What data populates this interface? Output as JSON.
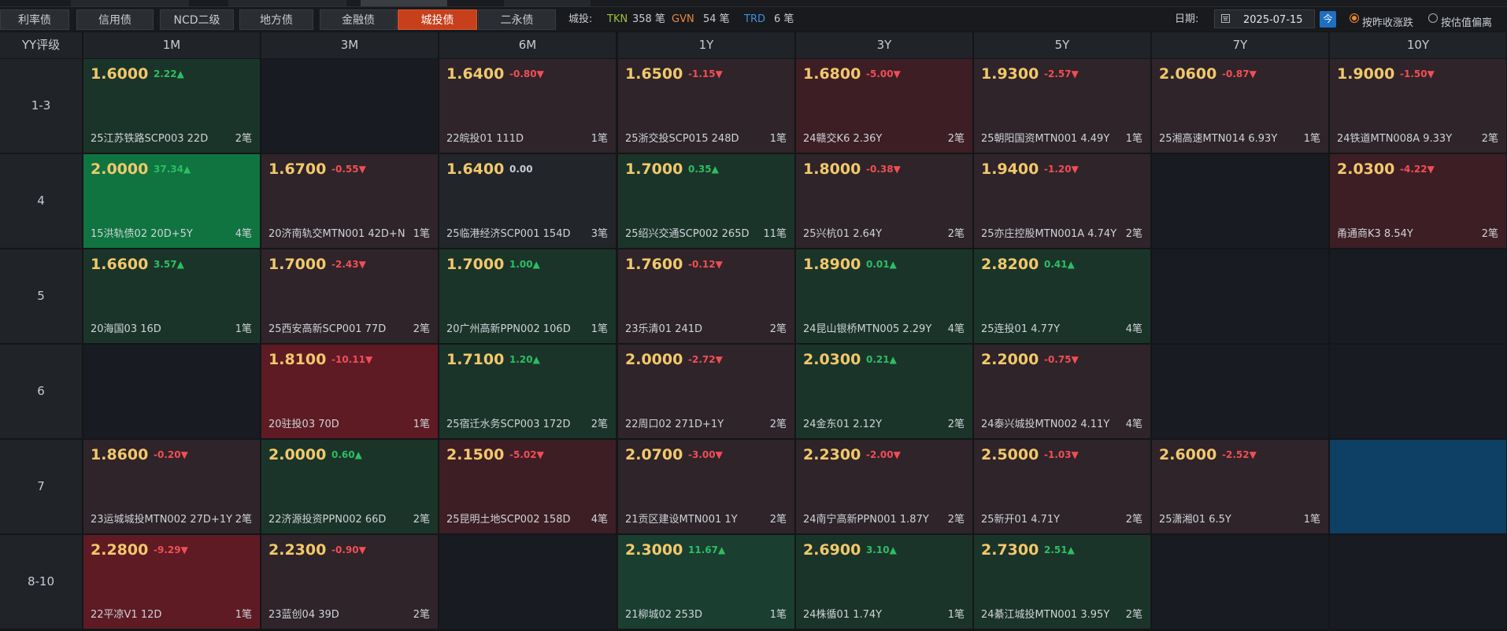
{
  "tabs": [
    {
      "label": "利率债",
      "active": false
    },
    {
      "label": "信用债",
      "active": false
    },
    {
      "label": "NCD二级",
      "active": false
    },
    {
      "label": "地方债",
      "active": false
    },
    {
      "label": "金融债",
      "active": false
    },
    {
      "label": "城投债",
      "active": true
    },
    {
      "label": "二永债",
      "active": false
    }
  ],
  "summary": {
    "prefix": "城投:",
    "items": [
      {
        "code": "TKN",
        "count": "358 笔",
        "color": "#9fc33a"
      },
      {
        "code": "GVN",
        "count": "54 笔",
        "color": "#e88a3c"
      },
      {
        "code": "TRD",
        "count": "6 笔",
        "color": "#3e8fe0"
      }
    ]
  },
  "date": {
    "label": "日期:",
    "value": "2025-07-15",
    "today_label": "今"
  },
  "radios": [
    {
      "label": "按昨收涨跌",
      "checked": true
    },
    {
      "label": "按估值偏离",
      "checked": false
    }
  ],
  "grid": {
    "corner": "YY评级",
    "columns": [
      "1M",
      "3M",
      "6M",
      "1Y",
      "3Y",
      "5Y",
      "7Y",
      "10Y"
    ],
    "rows": [
      "1-3",
      "4",
      "5",
      "6",
      "7",
      "8-10"
    ],
    "cells": [
      [
        {
          "value": "1.6000",
          "change": "2.22▲",
          "dir": "up",
          "bond": "25江苏铁路SCP003 22D",
          "count": "2笔",
          "shade": "dg"
        },
        {
          "shade": "em"
        },
        {
          "value": "1.6400",
          "change": "-0.80▼",
          "dir": "down",
          "bond": "22皖投01 111D",
          "count": "1笔",
          "shade": "dr"
        },
        {
          "value": "1.6500",
          "change": "-1.15▼",
          "dir": "down",
          "bond": "25浙交投SCP015 248D",
          "count": "1笔",
          "shade": "dr"
        },
        {
          "value": "1.6800",
          "change": "-5.00▼",
          "dir": "down",
          "bond": "24赣交K6 2.36Y",
          "count": "2笔",
          "shade": "mr"
        },
        {
          "value": "1.9300",
          "change": "-2.57▼",
          "dir": "down",
          "bond": "25朝阳国资MTN001 4.49Y",
          "count": "1笔",
          "shade": "dr"
        },
        {
          "value": "2.0600",
          "change": "-0.87▼",
          "dir": "down",
          "bond": "25湘高速MTN014 6.93Y",
          "count": "1笔",
          "shade": "dr"
        },
        {
          "value": "1.9000",
          "change": "-1.50▼",
          "dir": "down",
          "bond": "24铁道MTN008A 9.33Y",
          "count": "2笔",
          "shade": "dr"
        }
      ],
      [
        {
          "value": "2.0000",
          "change": "37.34▲",
          "dir": "up",
          "bond": "15洪轨债02 20D+5Y",
          "count": "4笔",
          "shade": "bg"
        },
        {
          "value": "1.6700",
          "change": "-0.55▼",
          "dir": "down",
          "bond": "20济南轨交MTN001 42D+N",
          "count": "1笔",
          "shade": "dr"
        },
        {
          "value": "1.6400",
          "change": "0.00",
          "dir": "flat",
          "bond": "25临港经济SCP001 154D",
          "count": "3笔",
          "shade": "ne"
        },
        {
          "value": "1.7000",
          "change": "0.35▲",
          "dir": "up",
          "bond": "25绍兴交通SCP002 265D",
          "count": "11笔",
          "shade": "dg"
        },
        {
          "value": "1.8000",
          "change": "-0.38▼",
          "dir": "down",
          "bond": "25兴杭01 2.64Y",
          "count": "2笔",
          "shade": "dr"
        },
        {
          "value": "1.9400",
          "change": "-1.20▼",
          "dir": "down",
          "bond": "25亦庄控股MTN001A 4.74Y",
          "count": "2笔",
          "shade": "dr"
        },
        {
          "shade": "em"
        },
        {
          "value": "2.0300",
          "change": "-4.22▼",
          "dir": "down",
          "bond": "甬通商K3 8.54Y",
          "count": "2笔",
          "shade": "mr"
        }
      ],
      [
        {
          "value": "1.6600",
          "change": "3.57▲",
          "dir": "up",
          "bond": "20海国03 16D",
          "count": "1笔",
          "shade": "dg"
        },
        {
          "value": "1.7000",
          "change": "-2.43▼",
          "dir": "down",
          "bond": "25西安高新SCP001 77D",
          "count": "2笔",
          "shade": "dr"
        },
        {
          "value": "1.7000",
          "change": "1.00▲",
          "dir": "up",
          "bond": "20广州高新PPN002 106D",
          "count": "1笔",
          "shade": "dg"
        },
        {
          "value": "1.7600",
          "change": "-0.12▼",
          "dir": "down",
          "bond": "23乐清01 241D",
          "count": "2笔",
          "shade": "dr"
        },
        {
          "value": "1.8900",
          "change": "0.01▲",
          "dir": "up",
          "bond": "24昆山银桥MTN005 2.29Y",
          "count": "4笔",
          "shade": "dg"
        },
        {
          "value": "2.8200",
          "change": "0.41▲",
          "dir": "up",
          "bond": "25连投01 4.77Y",
          "count": "4笔",
          "shade": "dg"
        },
        {
          "shade": "em"
        },
        {
          "shade": "em"
        }
      ],
      [
        {
          "shade": "em"
        },
        {
          "value": "1.8100",
          "change": "-10.11▼",
          "dir": "down",
          "bond": "20驻投03 70D",
          "count": "1笔",
          "shade": "br"
        },
        {
          "value": "1.7100",
          "change": "1.20▲",
          "dir": "up",
          "bond": "25宿迁水务SCP003 172D",
          "count": "2笔",
          "shade": "dg"
        },
        {
          "value": "2.0000",
          "change": "-2.72▼",
          "dir": "down",
          "bond": "22周口02 271D+1Y",
          "count": "2笔",
          "shade": "dr"
        },
        {
          "value": "2.0300",
          "change": "0.21▲",
          "dir": "up",
          "bond": "24金东01 2.12Y",
          "count": "2笔",
          "shade": "dg"
        },
        {
          "value": "2.2000",
          "change": "-0.75▼",
          "dir": "down",
          "bond": "24泰兴城投MTN002 4.11Y",
          "count": "4笔",
          "shade": "dr"
        },
        {
          "shade": "em"
        },
        {
          "shade": "em"
        }
      ],
      [
        {
          "value": "1.8600",
          "change": "-0.20▼",
          "dir": "down",
          "bond": "23运城城投MTN002 27D+1Y",
          "count": "2笔",
          "shade": "dr"
        },
        {
          "value": "2.0000",
          "change": "0.60▲",
          "dir": "up",
          "bond": "22济源投资PPN002 66D",
          "count": "2笔",
          "shade": "dg"
        },
        {
          "value": "2.1500",
          "change": "-5.02▼",
          "dir": "down",
          "bond": "25昆明土地SCP002 158D",
          "count": "4笔",
          "shade": "mr"
        },
        {
          "value": "2.0700",
          "change": "-3.00▼",
          "dir": "down",
          "bond": "21贡区建设MTN001 1Y",
          "count": "2笔",
          "shade": "dr"
        },
        {
          "value": "2.2300",
          "change": "-2.00▼",
          "dir": "down",
          "bond": "24南宁高新PPN001 1.87Y",
          "count": "2笔",
          "shade": "dr"
        },
        {
          "value": "2.5000",
          "change": "-1.03▼",
          "dir": "down",
          "bond": "25新开01 4.71Y",
          "count": "2笔",
          "shade": "dr"
        },
        {
          "value": "2.6000",
          "change": "-2.52▼",
          "dir": "down",
          "bond": "25潇湘01 6.5Y",
          "count": "1笔",
          "shade": "dr"
        },
        {
          "shade": "bl"
        }
      ],
      [
        {
          "value": "2.2800",
          "change": "-9.29▼",
          "dir": "down",
          "bond": "22平凉V1 12D",
          "count": "1笔",
          "shade": "br"
        },
        {
          "value": "2.2300",
          "change": "-0.90▼",
          "dir": "down",
          "bond": "23蓝创04 39D",
          "count": "2笔",
          "shade": "dr"
        },
        {
          "shade": "em"
        },
        {
          "value": "2.3000",
          "change": "11.67▲",
          "dir": "up",
          "bond": "21柳城02 253D",
          "count": "1笔",
          "shade": "mg"
        },
        {
          "value": "2.6900",
          "change": "3.10▲",
          "dir": "up",
          "bond": "24株循01 1.74Y",
          "count": "1笔",
          "shade": "dg"
        },
        {
          "value": "2.7300",
          "change": "2.51▲",
          "dir": "up",
          "bond": "24綦江城投MTN001 3.95Y",
          "count": "2笔",
          "shade": "dg"
        },
        {
          "shade": "em"
        },
        {
          "shade": "em"
        }
      ]
    ]
  }
}
